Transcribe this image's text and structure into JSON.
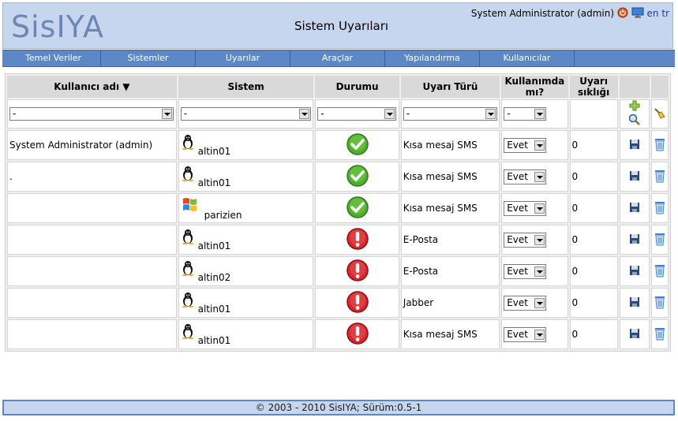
{
  "header": {
    "logo": "SisIYA",
    "page_title": "Sistem Uyarıları",
    "user": "System Administrator (admin)",
    "logout_icon": "power-icon",
    "monitor_icon": "monitor-icon",
    "lang_en": "en",
    "lang_tr": "tr"
  },
  "nav": [
    "Temel Veriler",
    "Sistemler",
    "Uyarılar",
    "Araçlar",
    "Yapılandırma",
    "Kullanıcılar"
  ],
  "table": {
    "headers": {
      "user": "Kullanıcı adı ▼",
      "system": "Sistem",
      "status": "Durumu",
      "alert_type": "Uyarı Türü",
      "enabled": "Kullanımda mı?",
      "frequency": "Uyarı sıklığı"
    },
    "filter": {
      "user": "-",
      "system": "-",
      "status": "-",
      "alert_type": "-",
      "enabled": "-"
    },
    "rows": [
      {
        "user": "System Administrator (admin)",
        "os": "linux",
        "system": "altin01",
        "status": "ok",
        "alert_type": "Kısa mesaj SMS",
        "enabled": "Evet",
        "frequency": "0"
      },
      {
        "user": ".",
        "os": "linux",
        "system": "altin01",
        "status": "ok",
        "alert_type": "Kısa mesaj SMS",
        "enabled": "Evet",
        "frequency": "0"
      },
      {
        "user": "",
        "os": "windows",
        "system": "parizien",
        "status": "ok",
        "alert_type": "Kısa mesaj SMS",
        "enabled": "Evet",
        "frequency": "0"
      },
      {
        "user": "",
        "os": "linux",
        "system": "altin01",
        "status": "error",
        "alert_type": "E-Posta",
        "enabled": "Evet",
        "frequency": "0"
      },
      {
        "user": "",
        "os": "linux",
        "system": "altin02",
        "status": "error",
        "alert_type": "E-Posta",
        "enabled": "Evet",
        "frequency": "0"
      },
      {
        "user": "",
        "os": "linux",
        "system": "altin01",
        "status": "error",
        "alert_type": "Jabber",
        "enabled": "Evet",
        "frequency": "0"
      },
      {
        "user": "",
        "os": "linux",
        "system": "altin01",
        "status": "error",
        "alert_type": "Kısa mesaj SMS",
        "enabled": "Evet",
        "frequency": "0"
      }
    ]
  },
  "footer": "© 2003 - 2010 SisIYA; Sürüm:0.5-1",
  "colors": {
    "header_bg": "#c6d6ee",
    "nav_bg": "#5e87c7",
    "ok": "#4fae2e",
    "error": "#d8262a"
  }
}
